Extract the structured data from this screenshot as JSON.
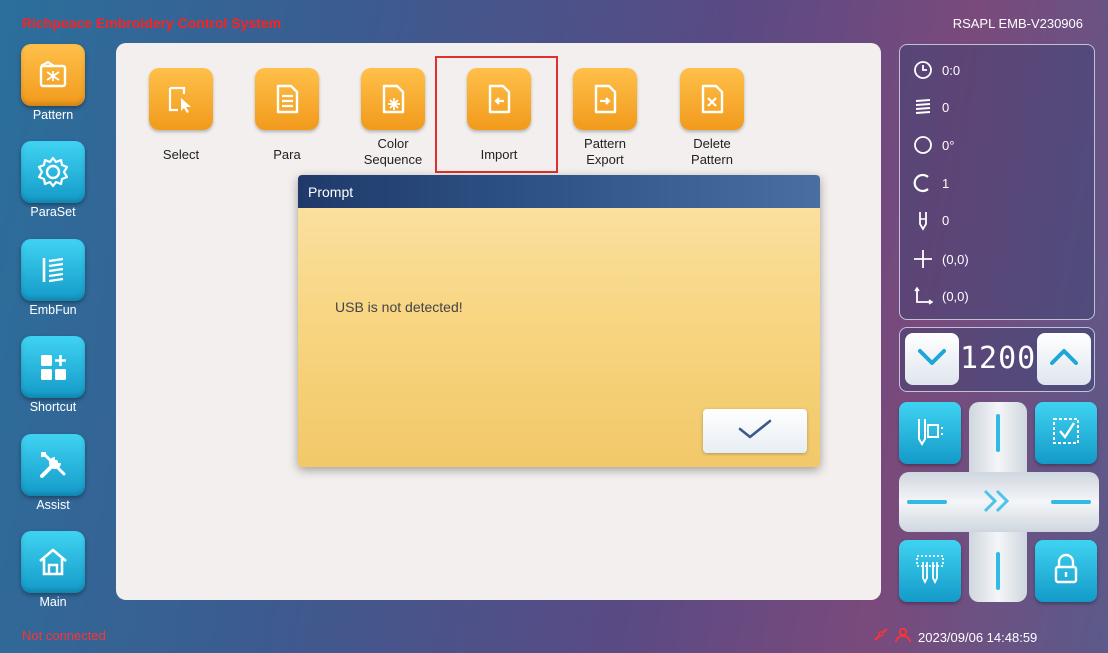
{
  "header": {
    "title": "Richpeace Embroidery Control System",
    "version": "RSAPL EMB-V230906"
  },
  "sidebar": {
    "items": [
      {
        "label": "Pattern",
        "icon": "pattern-icon"
      },
      {
        "label": "ParaSet",
        "icon": "gear-icon"
      },
      {
        "label": "EmbFun",
        "icon": "embroidery-function-icon"
      },
      {
        "label": "Shortcut",
        "icon": "shortcut-grid-icon"
      },
      {
        "label": "Assist",
        "icon": "tools-icon"
      },
      {
        "label": "Main",
        "icon": "home-icon"
      }
    ]
  },
  "toolbar": {
    "items": [
      {
        "label": "Select",
        "icon": "select-pointer-icon"
      },
      {
        "label": "Para",
        "icon": "document-icon"
      },
      {
        "label": "Color\nSequence",
        "icon": "color-sequence-icon"
      },
      {
        "label": "Import",
        "icon": "import-icon"
      },
      {
        "label": "Pattern\nExport",
        "icon": "export-icon"
      },
      {
        "label": "Delete\nPattern",
        "icon": "delete-file-icon"
      }
    ]
  },
  "dialog": {
    "title": "Prompt",
    "message": "USB is not detected!",
    "ok_icon": "checkmark-icon"
  },
  "status": {
    "time": "0:0",
    "stitches": "0",
    "angle": "0°",
    "color": "1",
    "needle": "0",
    "position": "(0,0)",
    "origin": "(0,0)"
  },
  "speed": {
    "value": "1200"
  },
  "footer": {
    "connection": "Not connected",
    "datetime": "2023/09/06 14:48:59"
  },
  "colors": {
    "accent_orange": "#f19a1c",
    "accent_cyan": "#149ac8",
    "error_red": "#ff3333"
  }
}
